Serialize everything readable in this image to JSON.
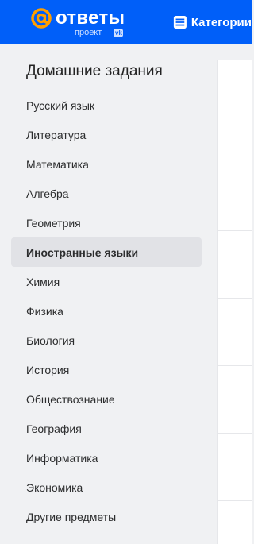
{
  "header": {
    "logo_word": "ответы",
    "logo_sub": "проект",
    "vk_badge": "vk",
    "categories_label": "Категории",
    "brand_color": "#005ff9",
    "accent_color": "#ff9e00"
  },
  "sidebar": {
    "title": "Домашние задания",
    "items": [
      {
        "label": "Русский язык"
      },
      {
        "label": "Литература"
      },
      {
        "label": "Математика"
      },
      {
        "label": "Алгебра"
      },
      {
        "label": "Геометрия"
      },
      {
        "label": "Иностранные языки",
        "active": true
      },
      {
        "label": "Химия"
      },
      {
        "label": "Физика"
      },
      {
        "label": "Биология"
      },
      {
        "label": "История"
      },
      {
        "label": "Обществознание"
      },
      {
        "label": "География"
      },
      {
        "label": "Информатика"
      },
      {
        "label": "Экономика"
      },
      {
        "label": "Другие предметы"
      }
    ]
  },
  "icons": {
    "logo": "at-sign-icon",
    "categories": "menu-list-icon"
  }
}
